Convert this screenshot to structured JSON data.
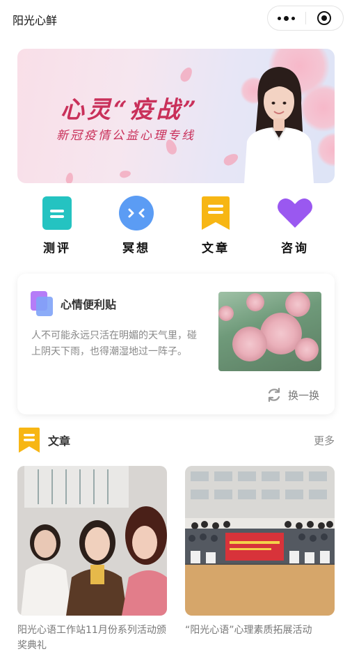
{
  "app": {
    "title": "阳光心鲜"
  },
  "banner": {
    "title": "心灵“疫战”",
    "subtitle": "新冠疫情公益心理专线"
  },
  "quick_actions": [
    {
      "label": "测评",
      "icon": "test-icon",
      "color": "#24c3c1"
    },
    {
      "label": "冥想",
      "icon": "meditation-icon",
      "color": "#5b9cf4"
    },
    {
      "label": "文章",
      "icon": "article-icon",
      "color": "#f7b614"
    },
    {
      "label": "咨询",
      "icon": "heart-icon",
      "color": "#9a58f0"
    }
  ],
  "mood_note": {
    "title": "心情便利贴",
    "text": "人不可能永远只活在明媚的天气里，碰上阴天下雨，也得潮湿地过一阵子。",
    "refresh_label": "换一换"
  },
  "articles_section": {
    "title": "文章",
    "more_label": "更多",
    "items": [
      {
        "caption": "阳光心语工作站11月份系列活动颁奖典礼"
      },
      {
        "caption": "“阳光心语”心理素质拓展活动"
      }
    ]
  }
}
